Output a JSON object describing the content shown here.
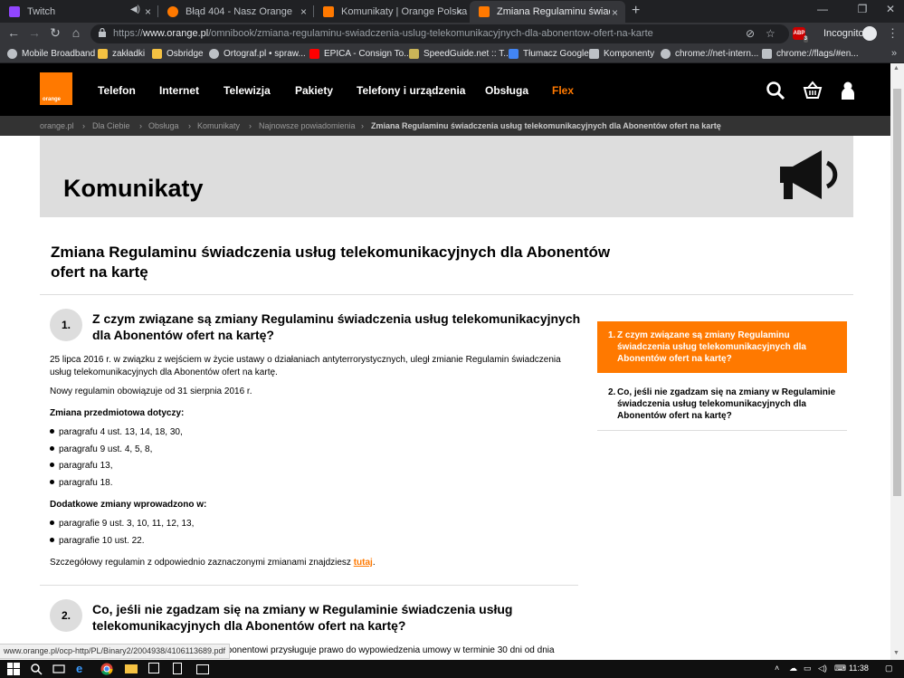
{
  "browser": {
    "tabs": [
      {
        "title": "Twitch",
        "favicon_color": "#9146ff",
        "audio_icon": true
      },
      {
        "title": "Błąd 404 - Nasz Orange",
        "favicon_color": "#ff7900"
      },
      {
        "title": "Komunikaty | Orange Polska",
        "favicon_color": "#ff7900"
      },
      {
        "title": "Zmiana Regulaminu świadczenia",
        "favicon_color": "#ff7900",
        "active": true
      }
    ],
    "new_tab_glyph": "+",
    "url_scheme": "https://",
    "url_host": "www.orange.pl",
    "url_path": "/omnibook/zmiana-regulaminu-swiadczenia-uslug-telekomunikacyjnych-dla-abonentow-ofert-na-karte",
    "incognito_label": "Incognito",
    "abp_badge": "3",
    "bookmarks": [
      {
        "label": "Mobile Broadband",
        "icon": "globe-icon",
        "color": "#bdc1c6"
      },
      {
        "label": "zakładki",
        "icon": "folder-icon",
        "color": "#f5c242"
      },
      {
        "label": "Osbridge",
        "icon": "folder-icon",
        "color": "#f5c242"
      },
      {
        "label": "Ortograf.pl • spraw...",
        "icon": "globe-icon",
        "color": "#bdc1c6"
      },
      {
        "label": "EPICA - Consign To...",
        "icon": "youtube-icon",
        "color": "#ff0000"
      },
      {
        "label": "SpeedGuide.net :: T...",
        "icon": "sg-icon",
        "color": "#c9b458"
      },
      {
        "label": "Tłumacz Google",
        "icon": "translate-icon",
        "color": "#4285f4"
      },
      {
        "label": "Komponenty",
        "icon": "puzzle-icon",
        "color": "#bdc1c6"
      },
      {
        "label": "chrome://net-intern...",
        "icon": "globe-icon",
        "color": "#bdc1c6"
      },
      {
        "label": "chrome://flags/#en...",
        "icon": "flask-icon",
        "color": "#bdc1c6"
      }
    ],
    "bookmarks_more": "»",
    "status_url": "www.orange.pl/ocp-http/PL/Binary2/2004938/4106113689.pdf"
  },
  "site": {
    "logo_text": "orange",
    "brand_color": "#ff7900",
    "nav_items": [
      "Telefon",
      "Internet",
      "Telewizja",
      "Pakiety",
      "Telefony i urządzenia",
      "Obsługa",
      "Flex"
    ],
    "breadcrumbs": [
      "orange.pl",
      "Dla Ciebie",
      "Obsługa",
      "Komunikaty",
      "Najnowsze powiadomienia",
      "Zmiana Regulaminu świadczenia usług telekomunikacyjnych dla Abonentów ofert na kartę"
    ],
    "breadcrumb_separator": "›",
    "hero_title": "Komunikaty"
  },
  "article": {
    "title": "Zmiana Regulaminu świadczenia usług telekomunikacyjnych dla Abonentów ofert na kartę",
    "sections": [
      {
        "number": "1.",
        "question": "Z czym związane są zmiany Regulaminu świadczenia usług telekomunikacyjnych dla Abonentów ofert na kartę?",
        "intro": "25 lipca 2016 r. w związku z wejściem w życie ustawy o działaniach antyterrorystycznych, uległ zmianie Regulamin świadczenia usług telekomunikacyjnych dla Abonentów ofert na kartę.",
        "effective": "Nowy regulamin obowiązuje od 31 sierpnia 2016 r.",
        "change_heading": "Zmiana przedmiotowa dotyczy:",
        "changes": [
          "paragrafu 4 ust. 13, 14, 18, 30,",
          "paragrafu 9 ust. 4, 5, 8,",
          "paragrafu 13,",
          "paragrafu 18."
        ],
        "extra_heading": "Dodatkowe zmiany wprowadzono w:",
        "extra_changes": [
          "paragrafie 9 ust. 3, 10, 11, 12, 13,",
          "paragrafie 10 ust. 22."
        ],
        "details_prefix": "Szczegółowy regulamin z odpowiednio zaznaczonymi zmianami znajdziesz ",
        "details_link": "tutaj",
        "details_suffix": "."
      },
      {
        "number": "2.",
        "question": "Co, jeśli nie zgadzam się na zmiany w Regulaminie świadczenia usług telekomunikacyjnych dla Abonentów ofert na kartę?",
        "partial_text": ", Abonentowi przysługuje prawo do wypowiedzenia umowy w terminie 30 dni od dnia"
      }
    ],
    "sidebar": [
      {
        "number": "1.",
        "label": "Z czym związane są zmiany Regulaminu świadczenia usług telekomunikacyjnych dla Abonentów ofert na kartę?",
        "active": true
      },
      {
        "number": "2.",
        "label": "Co, jeśli nie zgadzam się na zmiany w Regulaminie świadczenia usług telekomunikacyjnych dla Abonentów ofert na kartę?",
        "active": false
      }
    ]
  },
  "taskbar": {
    "time": "11:38"
  }
}
